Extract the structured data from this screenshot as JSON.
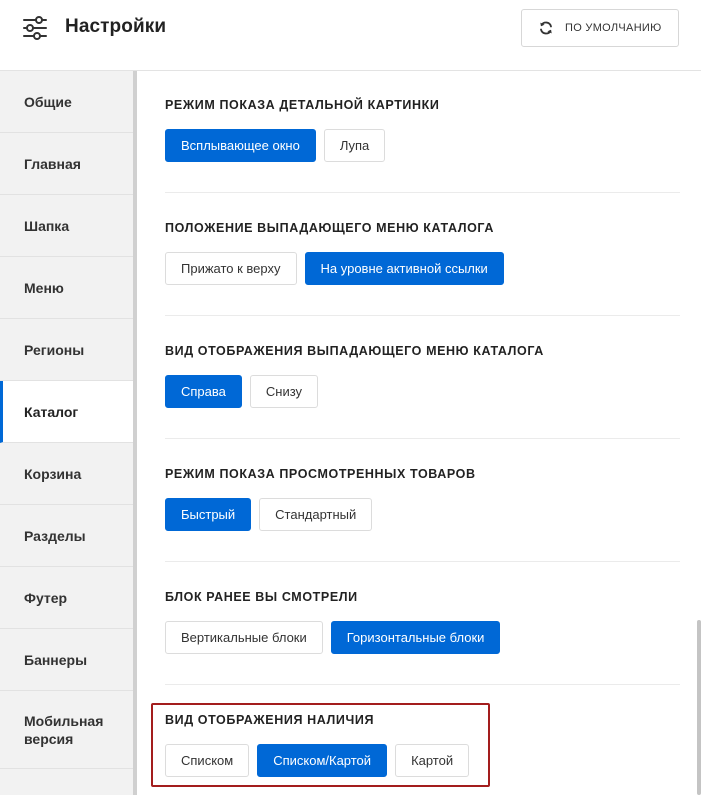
{
  "header": {
    "title": "Настройки",
    "reset_label": "ПО УМОЛЧАНИЮ",
    "icon": "sliders-icon",
    "reset_icon": "refresh-icon"
  },
  "colors": {
    "accent": "#0068d6",
    "highlight": "#a31d1d",
    "sidebar_bg": "#f2f2f2"
  },
  "sidebar": {
    "active": "Каталог",
    "items": [
      {
        "label": "Общие"
      },
      {
        "label": "Главная"
      },
      {
        "label": "Шапка"
      },
      {
        "label": "Меню"
      },
      {
        "label": "Регионы"
      },
      {
        "label": "Каталог"
      },
      {
        "label": "Корзина"
      },
      {
        "label": "Разделы"
      },
      {
        "label": "Футер"
      },
      {
        "label": "Баннеры"
      },
      {
        "label": "Мобильная версия"
      }
    ]
  },
  "sections": [
    {
      "title": "РЕЖИМ ПОКАЗА ДЕТАЛЬНОЙ КАРТИНКИ",
      "selected": "Всплывающее окно",
      "options": [
        "Всплывающее окно",
        "Лупа"
      ]
    },
    {
      "title": "ПОЛОЖЕНИЕ ВЫПАДАЮЩЕГО МЕНЮ КАТАЛОГА",
      "selected": "На уровне активной ссылки",
      "options": [
        "Прижато к верху",
        "На уровне активной ссылки"
      ]
    },
    {
      "title": "ВИД ОТОБРАЖЕНИЯ ВЫПАДАЮЩЕГО МЕНЮ КАТАЛОГА",
      "selected": "Справа",
      "options": [
        "Справа",
        "Снизу"
      ]
    },
    {
      "title": "РЕЖИМ ПОКАЗА ПРОСМОТРЕННЫХ ТОВАРОВ",
      "selected": "Быстрый",
      "options": [
        "Быстрый",
        "Стандартный"
      ]
    },
    {
      "title": "БЛОК РАНЕЕ ВЫ СМОТРЕЛИ",
      "selected": "Горизонтальные блоки",
      "options": [
        "Вертикальные блоки",
        "Горизонтальные блоки"
      ]
    },
    {
      "title": "ВИД ОТОБРАЖЕНИЯ НАЛИЧИЯ",
      "selected": "Списком/Картой",
      "options": [
        "Списком",
        "Списком/Картой",
        "Картой"
      ]
    }
  ]
}
